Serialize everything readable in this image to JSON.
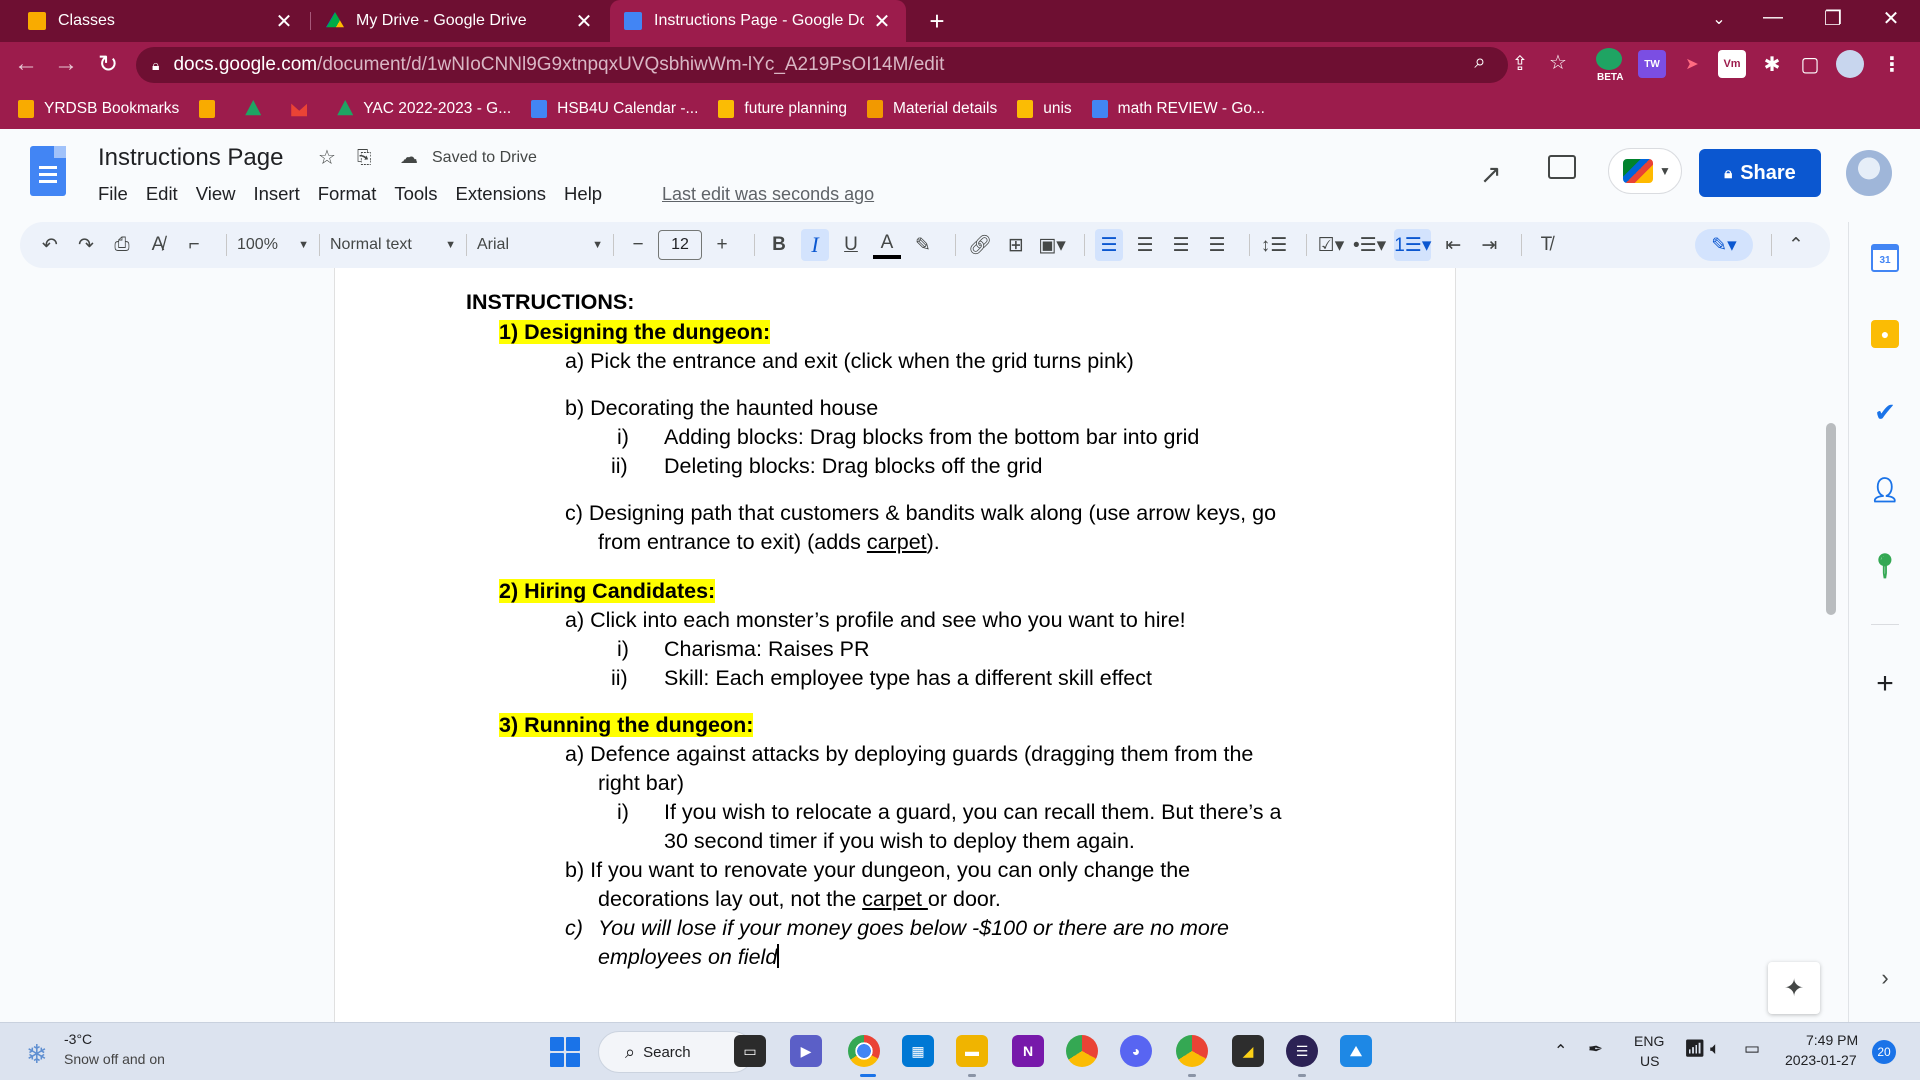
{
  "browser": {
    "tabs": [
      {
        "title": "Classes",
        "icon": "classroom-icon",
        "color": "#f9ab00"
      },
      {
        "title": "My Drive - Google Drive",
        "icon": "drive-icon",
        "color": "#1fa463"
      },
      {
        "title": "Instructions Page - Google Docs",
        "icon": "docs-icon",
        "color": "#4285f4"
      }
    ],
    "url_host": "docs.google.com",
    "url_path": "/document/d/1wNIoCNNl9G9xtnpqxUVQsbhiwWm-lYc_A219PsOI14M/edit",
    "beta_label": "BETA",
    "bookmarks": [
      {
        "label": "YRDSB Bookmarks",
        "color": "#f9ab00"
      },
      {
        "label": "",
        "color": "#f9ab00"
      },
      {
        "label": "",
        "color": "#1fa463"
      },
      {
        "label": "",
        "color": "#ea4335"
      },
      {
        "label": "YAC 2022-2023 - G...",
        "color": "#1fa463"
      },
      {
        "label": "HSB4U Calendar -...",
        "color": "#4285f4"
      },
      {
        "label": "future planning",
        "color": "#fbbc04"
      },
      {
        "label": "Material details",
        "color": "#f29900"
      },
      {
        "label": "unis",
        "color": "#fbbc04"
      },
      {
        "label": "math REVIEW - Go...",
        "color": "#4285f4"
      }
    ]
  },
  "docs": {
    "title": "Instructions Page",
    "saved_status": "Saved to Drive",
    "menu": [
      "File",
      "Edit",
      "View",
      "Insert",
      "Format",
      "Tools",
      "Extensions",
      "Help"
    ],
    "last_edit": "Last edit was seconds ago",
    "share_label": "Share"
  },
  "toolbar": {
    "zoom": "100%",
    "style": "Normal text",
    "font": "Arial",
    "font_size": "12",
    "bold": "B",
    "italic": "I",
    "underline": "U",
    "text_color": "A"
  },
  "document": {
    "heading": "INSTRUCTIONS:",
    "s1_title": "1)  Designing the dungeon:",
    "s1_a": "a)  Pick the entrance and exit (click when the grid turns pink)",
    "s1_b": "b)  Decorating the haunted house",
    "s1_b_i_num": "i)",
    "s1_b_i": "Adding blocks: Drag blocks from the bottom bar into grid",
    "s1_b_ii_num": "ii)",
    "s1_b_ii": "Deleting blocks: Drag blocks off the grid",
    "s1_c_line1": "c)  Designing path that customers & bandits walk along (use arrow keys, go",
    "s1_c_line2_pre": "from entrance to exit) (adds ",
    "s1_c_line2_link": "carpet",
    "s1_c_line2_post": ").",
    "s2_title": "2)  Hiring Candidates:",
    "s2_a": "a)  Click into each monster’s profile and see who you want to hire!",
    "s2_a_i_num": "i)",
    "s2_a_i": "Charisma: Raises PR",
    "s2_a_ii_num": "ii)",
    "s2_a_ii": "Skill: Each employee type has a different skill effect",
    "s3_title": "3)  Running the dungeon:",
    "s3_a_line1": "a)  Defence against attacks by deploying guards (dragging them from the",
    "s3_a_line2": "right bar)",
    "s3_a_i_num": "i)",
    "s3_a_i_line1": "If you wish to relocate a guard, you can recall them. But there’s a",
    "s3_a_i_line2": "30 second timer if you wish to deploy them again.",
    "s3_b_line1": "b)  If you want to renovate your dungeon, you can only change the",
    "s3_b_line2_pre": "decorations lay out, not the ",
    "s3_b_line2_link": "carpet ",
    "s3_b_line2_post": "or door.",
    "s3_c_num": "c)",
    "s3_c_line1": "You will lose if your money goes below -$100 or there are no more",
    "s3_c_line2": "employees on field"
  },
  "taskbar": {
    "temperature": "-3°C",
    "weather": "Snow off and on",
    "search": "Search",
    "lang": "ENG",
    "region": "US",
    "time": "7:49 PM",
    "date": "2023-01-27",
    "notifications": "20"
  },
  "colors": {
    "chrome_dark": "#6e0f32",
    "chrome_mid": "#9c1c4c",
    "highlight": "#ffff00",
    "share_blue": "#0b57d0"
  }
}
